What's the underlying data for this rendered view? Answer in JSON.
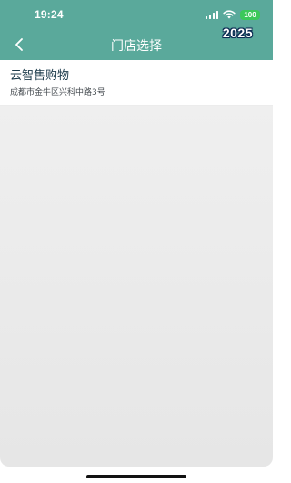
{
  "status_bar": {
    "time": "19:24",
    "battery": "100",
    "battery_color": "#3cc85a",
    "icons": [
      "signal-icon",
      "wifi-icon",
      "battery-icon"
    ]
  },
  "nav": {
    "title": "门店选择",
    "back_icon": "chevron-left-icon",
    "badge": "2025"
  },
  "colors": {
    "header": "#5aa99b",
    "badge_outline": "#0b2a52",
    "content_bg": "#ebebeb"
  },
  "stores": [
    {
      "name": "云智售购物",
      "address": "成都市金牛区兴科中路3号"
    }
  ]
}
